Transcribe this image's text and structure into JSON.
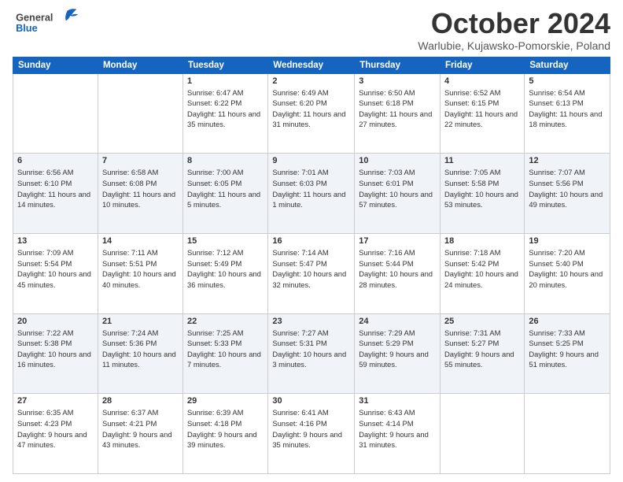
{
  "logo": {
    "general": "General",
    "blue": "Blue"
  },
  "header": {
    "month": "October 2024",
    "location": "Warlubie, Kujawsko-Pomorskie, Poland"
  },
  "weekdays": [
    "Sunday",
    "Monday",
    "Tuesday",
    "Wednesday",
    "Thursday",
    "Friday",
    "Saturday"
  ],
  "weeks": [
    [
      {
        "day": "",
        "sunrise": "",
        "sunset": "",
        "daylight": ""
      },
      {
        "day": "",
        "sunrise": "",
        "sunset": "",
        "daylight": ""
      },
      {
        "day": "1",
        "sunrise": "Sunrise: 6:47 AM",
        "sunset": "Sunset: 6:22 PM",
        "daylight": "Daylight: 11 hours and 35 minutes."
      },
      {
        "day": "2",
        "sunrise": "Sunrise: 6:49 AM",
        "sunset": "Sunset: 6:20 PM",
        "daylight": "Daylight: 11 hours and 31 minutes."
      },
      {
        "day": "3",
        "sunrise": "Sunrise: 6:50 AM",
        "sunset": "Sunset: 6:18 PM",
        "daylight": "Daylight: 11 hours and 27 minutes."
      },
      {
        "day": "4",
        "sunrise": "Sunrise: 6:52 AM",
        "sunset": "Sunset: 6:15 PM",
        "daylight": "Daylight: 11 hours and 22 minutes."
      },
      {
        "day": "5",
        "sunrise": "Sunrise: 6:54 AM",
        "sunset": "Sunset: 6:13 PM",
        "daylight": "Daylight: 11 hours and 18 minutes."
      }
    ],
    [
      {
        "day": "6",
        "sunrise": "Sunrise: 6:56 AM",
        "sunset": "Sunset: 6:10 PM",
        "daylight": "Daylight: 11 hours and 14 minutes."
      },
      {
        "day": "7",
        "sunrise": "Sunrise: 6:58 AM",
        "sunset": "Sunset: 6:08 PM",
        "daylight": "Daylight: 11 hours and 10 minutes."
      },
      {
        "day": "8",
        "sunrise": "Sunrise: 7:00 AM",
        "sunset": "Sunset: 6:05 PM",
        "daylight": "Daylight: 11 hours and 5 minutes."
      },
      {
        "day": "9",
        "sunrise": "Sunrise: 7:01 AM",
        "sunset": "Sunset: 6:03 PM",
        "daylight": "Daylight: 11 hours and 1 minute."
      },
      {
        "day": "10",
        "sunrise": "Sunrise: 7:03 AM",
        "sunset": "Sunset: 6:01 PM",
        "daylight": "Daylight: 10 hours and 57 minutes."
      },
      {
        "day": "11",
        "sunrise": "Sunrise: 7:05 AM",
        "sunset": "Sunset: 5:58 PM",
        "daylight": "Daylight: 10 hours and 53 minutes."
      },
      {
        "day": "12",
        "sunrise": "Sunrise: 7:07 AM",
        "sunset": "Sunset: 5:56 PM",
        "daylight": "Daylight: 10 hours and 49 minutes."
      }
    ],
    [
      {
        "day": "13",
        "sunrise": "Sunrise: 7:09 AM",
        "sunset": "Sunset: 5:54 PM",
        "daylight": "Daylight: 10 hours and 45 minutes."
      },
      {
        "day": "14",
        "sunrise": "Sunrise: 7:11 AM",
        "sunset": "Sunset: 5:51 PM",
        "daylight": "Daylight: 10 hours and 40 minutes."
      },
      {
        "day": "15",
        "sunrise": "Sunrise: 7:12 AM",
        "sunset": "Sunset: 5:49 PM",
        "daylight": "Daylight: 10 hours and 36 minutes."
      },
      {
        "day": "16",
        "sunrise": "Sunrise: 7:14 AM",
        "sunset": "Sunset: 5:47 PM",
        "daylight": "Daylight: 10 hours and 32 minutes."
      },
      {
        "day": "17",
        "sunrise": "Sunrise: 7:16 AM",
        "sunset": "Sunset: 5:44 PM",
        "daylight": "Daylight: 10 hours and 28 minutes."
      },
      {
        "day": "18",
        "sunrise": "Sunrise: 7:18 AM",
        "sunset": "Sunset: 5:42 PM",
        "daylight": "Daylight: 10 hours and 24 minutes."
      },
      {
        "day": "19",
        "sunrise": "Sunrise: 7:20 AM",
        "sunset": "Sunset: 5:40 PM",
        "daylight": "Daylight: 10 hours and 20 minutes."
      }
    ],
    [
      {
        "day": "20",
        "sunrise": "Sunrise: 7:22 AM",
        "sunset": "Sunset: 5:38 PM",
        "daylight": "Daylight: 10 hours and 16 minutes."
      },
      {
        "day": "21",
        "sunrise": "Sunrise: 7:24 AM",
        "sunset": "Sunset: 5:36 PM",
        "daylight": "Daylight: 10 hours and 11 minutes."
      },
      {
        "day": "22",
        "sunrise": "Sunrise: 7:25 AM",
        "sunset": "Sunset: 5:33 PM",
        "daylight": "Daylight: 10 hours and 7 minutes."
      },
      {
        "day": "23",
        "sunrise": "Sunrise: 7:27 AM",
        "sunset": "Sunset: 5:31 PM",
        "daylight": "Daylight: 10 hours and 3 minutes."
      },
      {
        "day": "24",
        "sunrise": "Sunrise: 7:29 AM",
        "sunset": "Sunset: 5:29 PM",
        "daylight": "Daylight: 9 hours and 59 minutes."
      },
      {
        "day": "25",
        "sunrise": "Sunrise: 7:31 AM",
        "sunset": "Sunset: 5:27 PM",
        "daylight": "Daylight: 9 hours and 55 minutes."
      },
      {
        "day": "26",
        "sunrise": "Sunrise: 7:33 AM",
        "sunset": "Sunset: 5:25 PM",
        "daylight": "Daylight: 9 hours and 51 minutes."
      }
    ],
    [
      {
        "day": "27",
        "sunrise": "Sunrise: 6:35 AM",
        "sunset": "Sunset: 4:23 PM",
        "daylight": "Daylight: 9 hours and 47 minutes."
      },
      {
        "day": "28",
        "sunrise": "Sunrise: 6:37 AM",
        "sunset": "Sunset: 4:21 PM",
        "daylight": "Daylight: 9 hours and 43 minutes."
      },
      {
        "day": "29",
        "sunrise": "Sunrise: 6:39 AM",
        "sunset": "Sunset: 4:18 PM",
        "daylight": "Daylight: 9 hours and 39 minutes."
      },
      {
        "day": "30",
        "sunrise": "Sunrise: 6:41 AM",
        "sunset": "Sunset: 4:16 PM",
        "daylight": "Daylight: 9 hours and 35 minutes."
      },
      {
        "day": "31",
        "sunrise": "Sunrise: 6:43 AM",
        "sunset": "Sunset: 4:14 PM",
        "daylight": "Daylight: 9 hours and 31 minutes."
      },
      {
        "day": "",
        "sunrise": "",
        "sunset": "",
        "daylight": ""
      },
      {
        "day": "",
        "sunrise": "",
        "sunset": "",
        "daylight": ""
      }
    ]
  ]
}
